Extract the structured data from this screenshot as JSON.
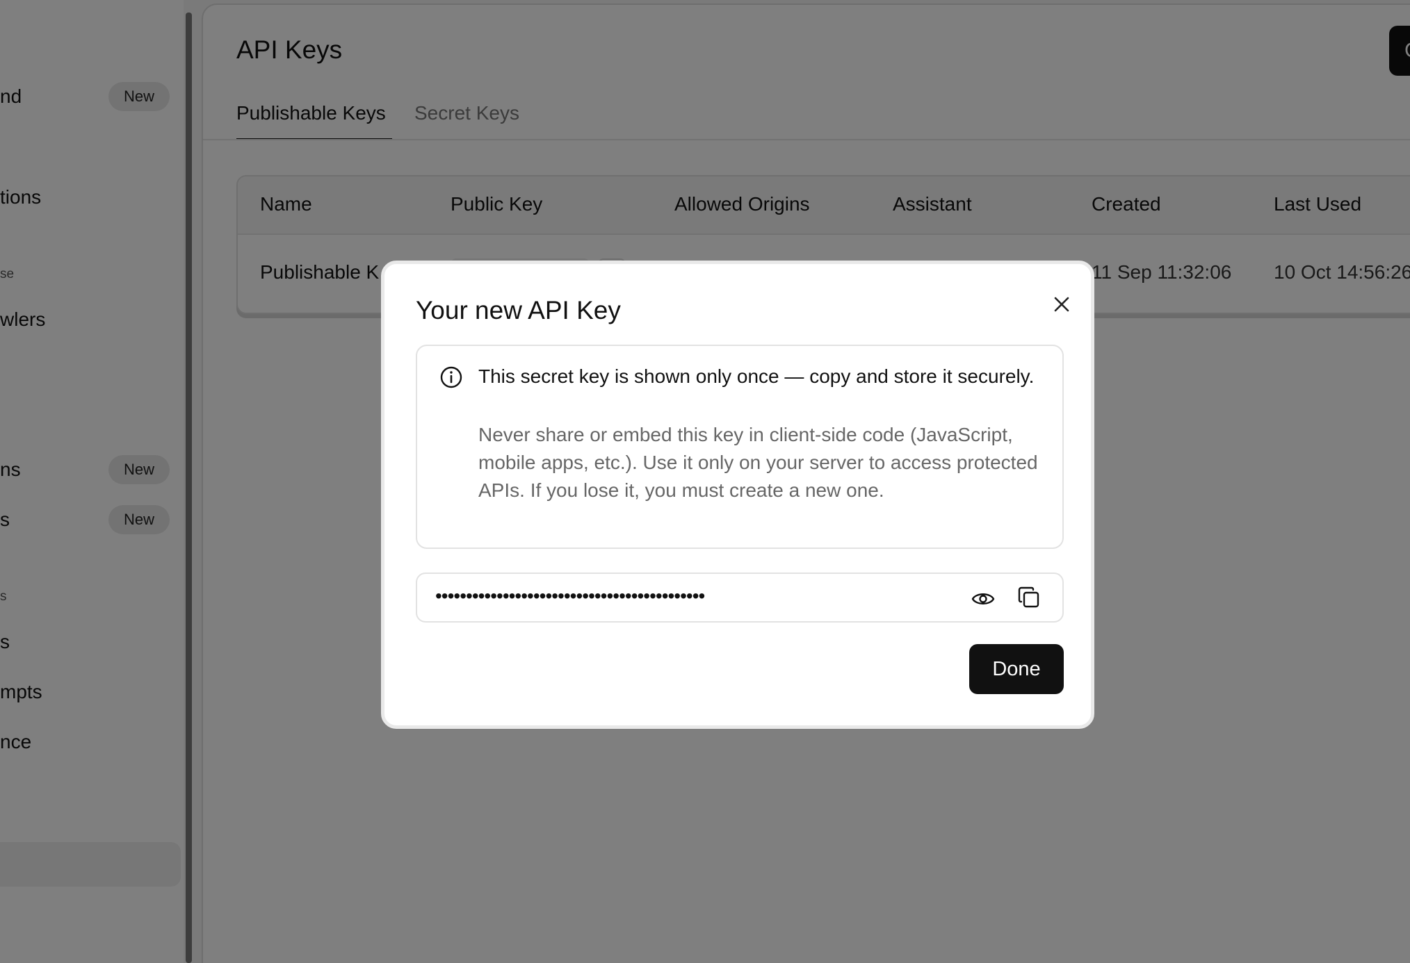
{
  "sidebar": {
    "items": [
      {
        "label": "nd",
        "badge": "New"
      },
      {
        "label": "tions",
        "badge": ""
      },
      {
        "label": "se",
        "badge": ""
      },
      {
        "label": "wlers",
        "badge": ""
      },
      {
        "label": "ns",
        "badge": "New"
      },
      {
        "label": "s",
        "badge": "New"
      },
      {
        "label": "s",
        "badge": ""
      },
      {
        "label": "s",
        "badge": ""
      },
      {
        "label": "mpts",
        "badge": ""
      },
      {
        "label": "nce",
        "badge": ""
      }
    ]
  },
  "main": {
    "title": "API Keys",
    "top_button_label": "C",
    "tabs": [
      {
        "label": "Publishable Keys",
        "active": true
      },
      {
        "label": "Secret Keys",
        "active": false
      }
    ],
    "table": {
      "columns": [
        "Name",
        "Public Key",
        "Allowed Origins",
        "Assistant",
        "Created",
        "Last Used"
      ],
      "rows": [
        {
          "name": "Publishable K",
          "created": "11 Sep 11:32:06",
          "last_used": "10 Oct 14:56:26"
        }
      ]
    }
  },
  "modal": {
    "title": "Your new API Key",
    "notice_heading": "This secret key is shown only once — copy and store it securely.",
    "notice_body": "Never share or embed this key in client-side code (JavaScript, mobile apps, etc.). Use it only on your server to access protected APIs. If you lose it, you must create a new one.",
    "masked_key": "••••••••••••••••••••••••••••••••••••••••••••",
    "done_label": "Done"
  },
  "icons": {
    "close": "close-icon",
    "info": "info-icon",
    "eye": "eye-icon",
    "copy": "copy-icon"
  }
}
